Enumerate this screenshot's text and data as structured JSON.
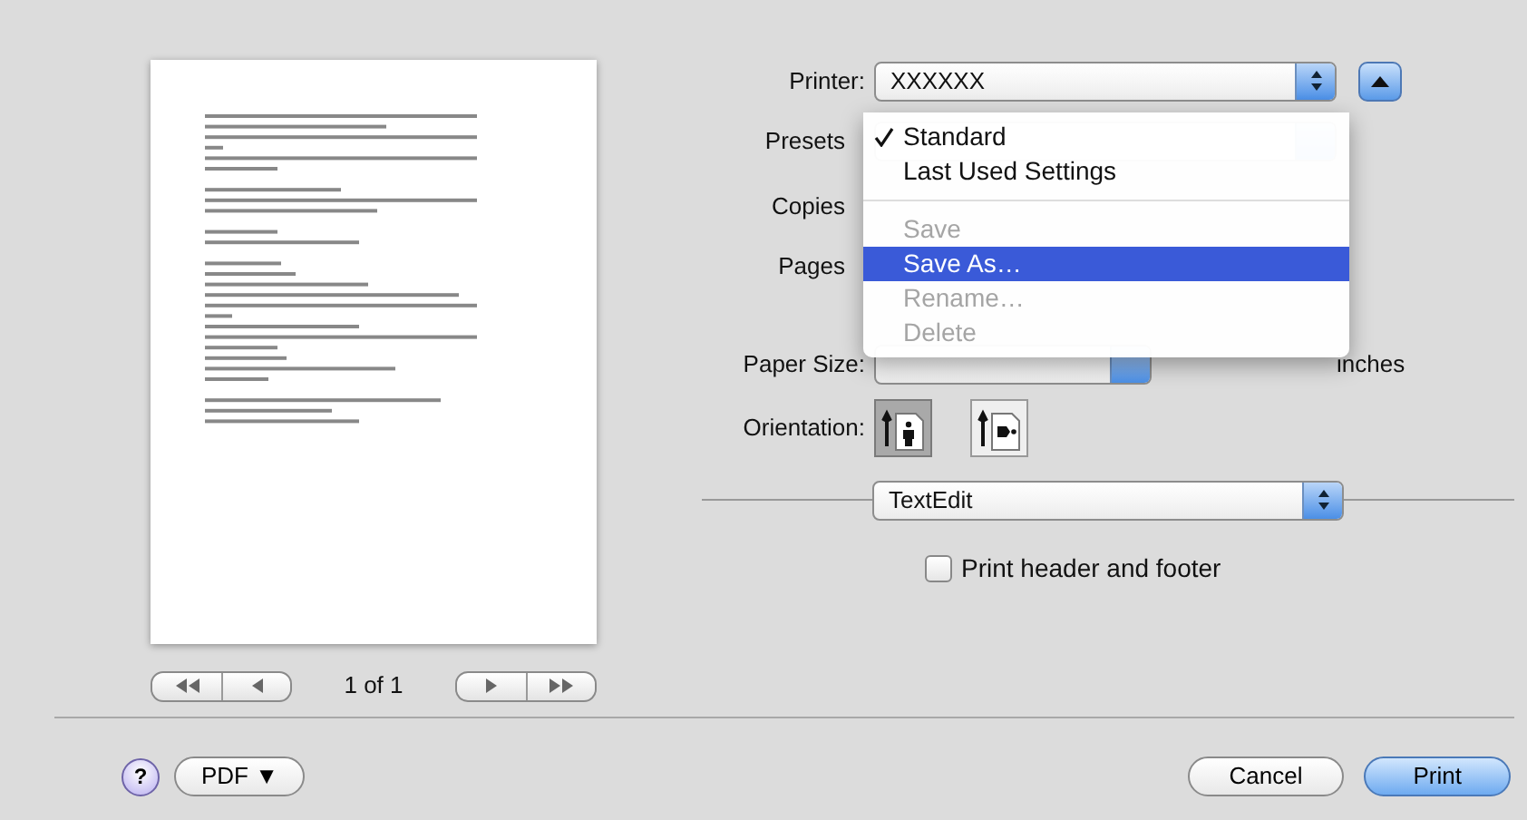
{
  "preview": {
    "page_indicator": "1 of 1"
  },
  "printer": {
    "label": "Printer:",
    "value": "XXXXXX"
  },
  "presets": {
    "label": "Presets",
    "menu": [
      {
        "kind": "item",
        "label": "Standard",
        "checked": true,
        "selected": false,
        "disabled": false
      },
      {
        "kind": "item",
        "label": "Last Used Settings",
        "checked": false,
        "selected": false,
        "disabled": false
      },
      {
        "kind": "separator"
      },
      {
        "kind": "item",
        "label": "Save",
        "checked": false,
        "selected": false,
        "disabled": true
      },
      {
        "kind": "item",
        "label": "Save As…",
        "checked": false,
        "selected": true,
        "disabled": false
      },
      {
        "kind": "item",
        "label": "Rename…",
        "checked": false,
        "selected": false,
        "disabled": true
      },
      {
        "kind": "item",
        "label": "Delete",
        "checked": false,
        "selected": false,
        "disabled": true
      }
    ]
  },
  "copies": {
    "label": "Copies"
  },
  "pages": {
    "label": "Pages"
  },
  "paper_size": {
    "label": "Paper Size:",
    "dimensions": "inches"
  },
  "orientation": {
    "label": "Orientation:",
    "options": [
      {
        "kind": "portrait",
        "selected": true
      },
      {
        "kind": "landscape",
        "selected": false
      }
    ]
  },
  "section_popup": {
    "value": "TextEdit"
  },
  "print_header_footer": {
    "label": "Print header and footer",
    "checked": false
  },
  "footer": {
    "help": "?",
    "pdf": "PDF ▼",
    "cancel": "Cancel",
    "print": "Print"
  }
}
